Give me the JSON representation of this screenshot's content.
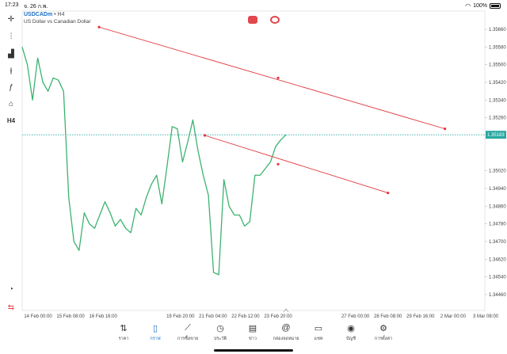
{
  "status": {
    "time": "17:23",
    "date": "จ. 26 ก.พ.",
    "battery": "100%"
  },
  "symbol": {
    "name": "USDCADm",
    "sep": " • ",
    "timeframe": "H4",
    "description": "US Dollar vs Canadian Dollar"
  },
  "toolbar": {
    "items": [
      {
        "name": "crosshair",
        "glyph": "✛"
      },
      {
        "name": "chart-type",
        "glyph": "⫶"
      },
      {
        "name": "indicators",
        "glyph": "▟"
      },
      {
        "name": "objects",
        "glyph": "⫲"
      },
      {
        "name": "function",
        "glyph": "ƒ"
      },
      {
        "name": "shapes",
        "glyph": "⌂"
      },
      {
        "name": "timeframe",
        "glyph": "H4"
      }
    ],
    "bottom_items": [
      {
        "name": "alerts",
        "glyph": "◔"
      },
      {
        "name": "trade",
        "glyph": "⇆"
      }
    ]
  },
  "chart_data": {
    "type": "line",
    "price_ticks": [
      "1.35660",
      "1.35580",
      "1.35500",
      "1.35420",
      "1.35340",
      "1.35260",
      "1.35183",
      "1.35020",
      "1.34940",
      "1.34860",
      "1.34780",
      "1.34700",
      "1.34620",
      "1.34540",
      "1.34460"
    ],
    "current_price": "1.35183",
    "time_ticks": [
      "14 Feb 00:00",
      "15 Feb 08:00",
      "16 Feb 16:00",
      "19 Feb 20:00",
      "21 Feb 04:00",
      "22 Feb 12:00",
      "23 Feb 20:00",
      "27 Feb 00:00",
      "28 Feb 08:00",
      "29 Feb 16:00",
      "2 Mar 00:00",
      "3 Mar 08:00"
    ],
    "series": [
      {
        "values": [
          1.3558,
          1.355,
          1.3534,
          1.3553,
          1.3542,
          1.3538,
          1.3544,
          1.3543,
          1.3538,
          1.349,
          1.347,
          1.3466,
          1.3483,
          1.3478,
          1.3476,
          1.3482,
          1.3488,
          1.3483,
          1.3477,
          1.348,
          1.3476,
          1.3474,
          1.3485,
          1.3482,
          1.349,
          1.3496,
          1.35,
          1.3487,
          1.3504,
          1.3522,
          1.3521,
          1.3506,
          1.3515,
          1.3525,
          1.3511,
          1.35,
          1.3491,
          1.3456,
          1.3455,
          1.3498,
          1.3486,
          1.3482,
          1.3482,
          1.3477,
          1.3479,
          1.35,
          1.35,
          1.3503,
          1.3506,
          1.3513,
          1.3516,
          1.35183
        ]
      }
    ],
    "trendlines": [
      {
        "from": [
          "16 Feb 12:00",
          1.3567
        ],
        "mid": [
          "23 Feb 20:00",
          1.3544
        ],
        "to": [
          "1 Mar 16:00",
          1.3521
        ]
      },
      {
        "from": [
          "20 Feb 20:00",
          1.3518
        ],
        "mid": [
          "23 Feb 20:00",
          1.3505
        ],
        "to": [
          "28 Feb 08:00",
          1.3492
        ]
      }
    ],
    "colors": {
      "line": "#3bb36f",
      "trend": "#e0363c",
      "price_tag": "#2aa7a0",
      "grid": "#e8e8e8"
    }
  },
  "nav": [
    {
      "label": "ราคา",
      "icon": "⇅"
    },
    {
      "label": "กราฟ",
      "icon": "▯",
      "active": true
    },
    {
      "label": "การซื้อขาย",
      "icon": "⟋"
    },
    {
      "label": "ประวัติ",
      "icon": "◷"
    },
    {
      "label": "ข่าว",
      "icon": "▤"
    },
    {
      "label": "กล่องจดหมาย",
      "icon": "@"
    },
    {
      "label": "แชท",
      "icon": "▭"
    },
    {
      "label": "บัญชี",
      "icon": "◉"
    },
    {
      "label": "การตั้งค่า",
      "icon": "⚙"
    }
  ]
}
